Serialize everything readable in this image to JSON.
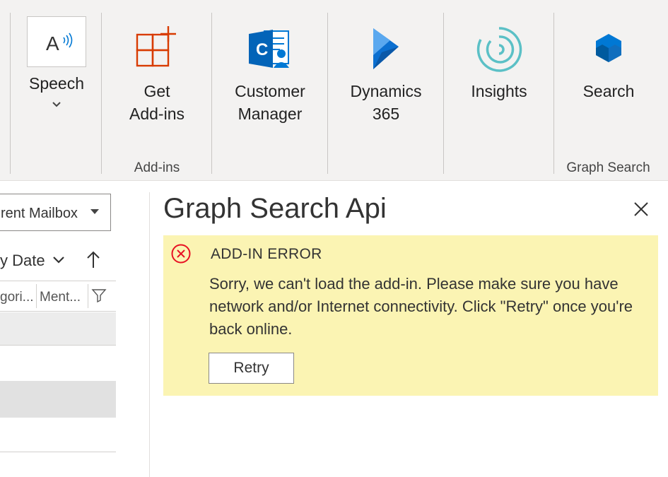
{
  "ribbon": {
    "speech": {
      "label": "Speech",
      "glyph": "A",
      "icon": "read-aloud-icon"
    },
    "get_addins": {
      "label_line1": "Get",
      "label_line2": "Add-ins",
      "icon": "add-ins-icon",
      "color": "#d83b01"
    },
    "customer_manager": {
      "label_line1": "Customer",
      "label_line2": "Manager",
      "icon": "customer-manager-icon",
      "color": "#0078d4"
    },
    "dynamics": {
      "label_line1": "Dynamics",
      "label_line2": "365",
      "icon": "dynamics-365-icon",
      "color": "#0078d4"
    },
    "insights": {
      "label": "Insights",
      "icon": "insights-icon",
      "color": "#5bc0c6"
    },
    "search": {
      "label": "Search",
      "icon": "graph-search-icon",
      "color": "#0078d4"
    },
    "groups": {
      "addins": "Add-ins",
      "graph_search": "Graph Search"
    }
  },
  "left_pane": {
    "mailbox": "rent Mailbox",
    "sort": "y Date",
    "columns": [
      "gori...",
      "Ment..."
    ]
  },
  "addin_pane": {
    "title": "Graph Search Api",
    "error": {
      "title": "ADD-IN ERROR",
      "message": "Sorry, we can't load the add-in. Please make sure you have network and/or Internet connectivity. Click \"Retry\" once you're back online.",
      "retry": "Retry",
      "accent": "#e81123",
      "background": "#fbf4b3"
    }
  }
}
